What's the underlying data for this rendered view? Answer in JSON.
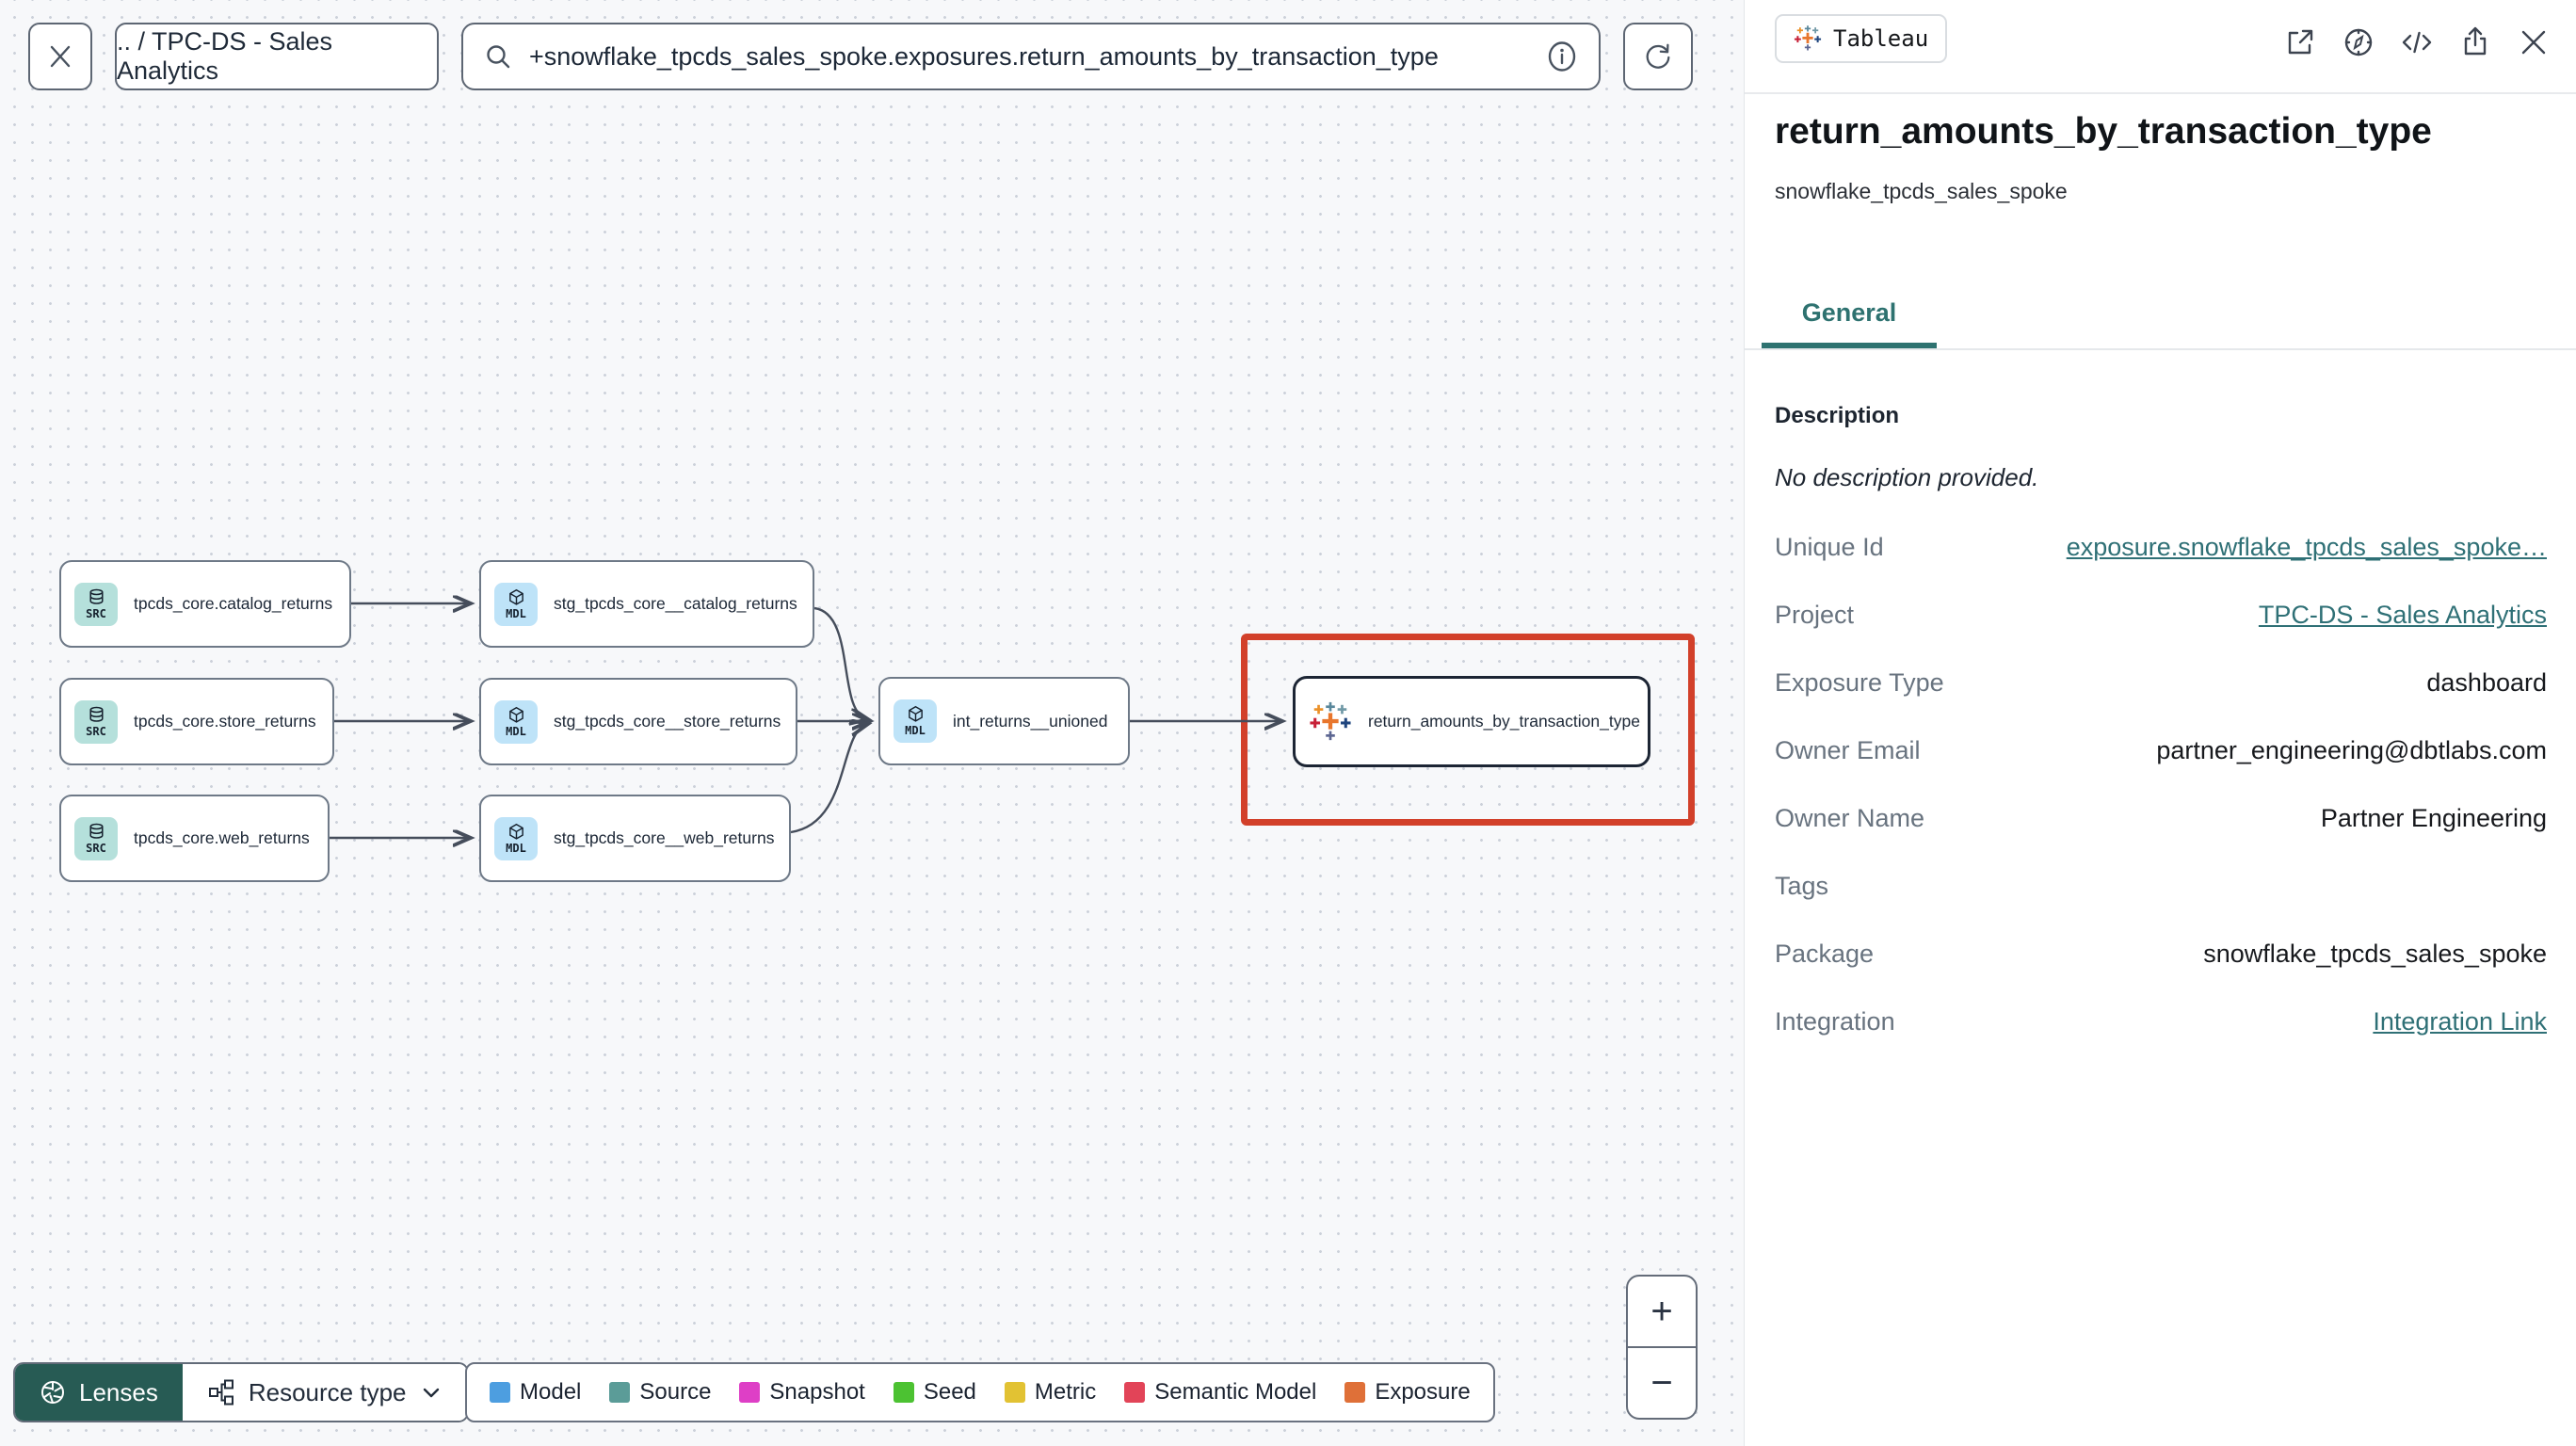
{
  "toolbar": {
    "breadcrumb": ".. / TPC-DS - Sales Analytics",
    "search_value": "+snowflake_tpcds_sales_spoke.exposures.return_amounts_by_transaction_type"
  },
  "canvas": {
    "nodes": [
      {
        "badge": "SRC",
        "label": "tpcds_core.catalog_returns"
      },
      {
        "badge": "SRC",
        "label": "tpcds_core.store_returns"
      },
      {
        "badge": "SRC",
        "label": "tpcds_core.web_returns"
      },
      {
        "badge": "MDL",
        "label": "stg_tpcds_core__catalog_returns"
      },
      {
        "badge": "MDL",
        "label": "stg_tpcds_core__store_returns"
      },
      {
        "badge": "MDL",
        "label": "stg_tpcds_core__web_returns"
      },
      {
        "badge": "MDL",
        "label": "int_returns__unioned"
      },
      {
        "label": "return_amounts_by_transaction_type"
      }
    ],
    "controls": {
      "lenses": "Lenses",
      "resource_type": "Resource type",
      "zoom_in": "+",
      "zoom_out": "−"
    },
    "legend": {
      "items": [
        {
          "label": "Model",
          "color": "#4D9EE0"
        },
        {
          "label": "Source",
          "color": "#5B9C98"
        },
        {
          "label": "Snapshot",
          "color": "#DE3FC6"
        },
        {
          "label": "Seed",
          "color": "#4CC232"
        },
        {
          "label": "Metric",
          "color": "#E2C233"
        },
        {
          "label": "Semantic Model",
          "color": "#E24458"
        },
        {
          "label": "Exposure",
          "color": "#DF7038"
        }
      ]
    }
  },
  "panel": {
    "source_badge": "Tableau",
    "title": "return_amounts_by_transaction_type",
    "subtitle": "snowflake_tpcds_sales_spoke",
    "tabs": [
      {
        "label": "General"
      }
    ],
    "description_label": "Description",
    "description_value": "No description provided.",
    "rows": [
      {
        "label": "Unique Id",
        "value": "exposure.snowflake_tpcds_sales_spoke…",
        "link": true
      },
      {
        "label": "Project",
        "value": "TPC-DS - Sales Analytics",
        "link": true
      },
      {
        "label": "Exposure Type",
        "value": "dashboard",
        "link": false
      },
      {
        "label": "Owner Email",
        "value": "partner_engineering@dbtlabs.com",
        "link": false
      },
      {
        "label": "Owner Name",
        "value": "Partner Engineering",
        "link": false
      },
      {
        "label": "Tags",
        "value": "",
        "link": false
      },
      {
        "label": "Package",
        "value": "snowflake_tpcds_sales_spoke",
        "link": false
      },
      {
        "label": "Integration",
        "value": "Integration Link",
        "link": true
      }
    ]
  },
  "colors": {
    "accent_teal": "#2E7270",
    "selection_highlight": "#D2402A",
    "source_badge_bg": "#B5E0DB",
    "model_badge_bg": "#BEE3F8",
    "edge": "#454d5b"
  }
}
